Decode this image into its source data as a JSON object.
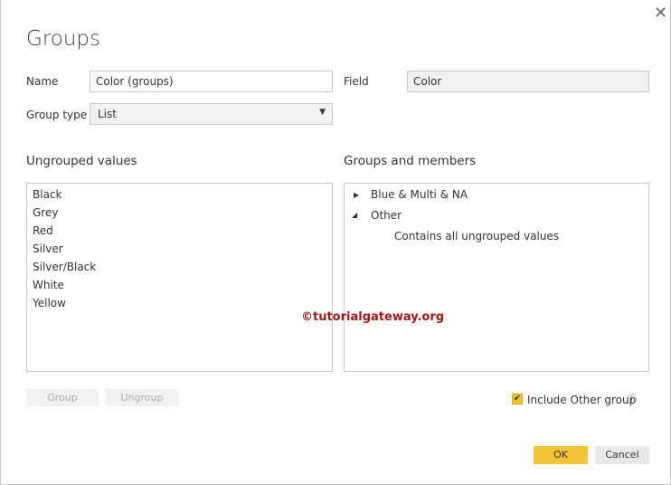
{
  "dialog": {
    "title": "Groups",
    "close_icon": "close-icon"
  },
  "form": {
    "name_label": "Name",
    "name_value": "Color (groups)",
    "field_label": "Field",
    "field_value": "Color",
    "group_type_label": "Group type",
    "group_type_value": "List"
  },
  "ungrouped": {
    "heading": "Ungrouped values",
    "items": [
      "Black",
      "Grey",
      "Red",
      "Silver",
      "Silver/Black",
      "White",
      "Yellow"
    ]
  },
  "groups": {
    "heading": "Groups and members",
    "items": [
      {
        "label": "Blue & Multi & NA",
        "expanded": false
      },
      {
        "label": "Other",
        "expanded": true,
        "member": "Contains all ungrouped values"
      }
    ]
  },
  "buttons": {
    "group": "Group",
    "ungroup": "Ungroup",
    "ok": "OK",
    "cancel": "Cancel"
  },
  "include_other": {
    "label": "Include Other group",
    "checked": true
  },
  "watermark": "©tutorialgateway.org",
  "colors": {
    "accent": "#f2c438",
    "watermark": "#a01818"
  }
}
